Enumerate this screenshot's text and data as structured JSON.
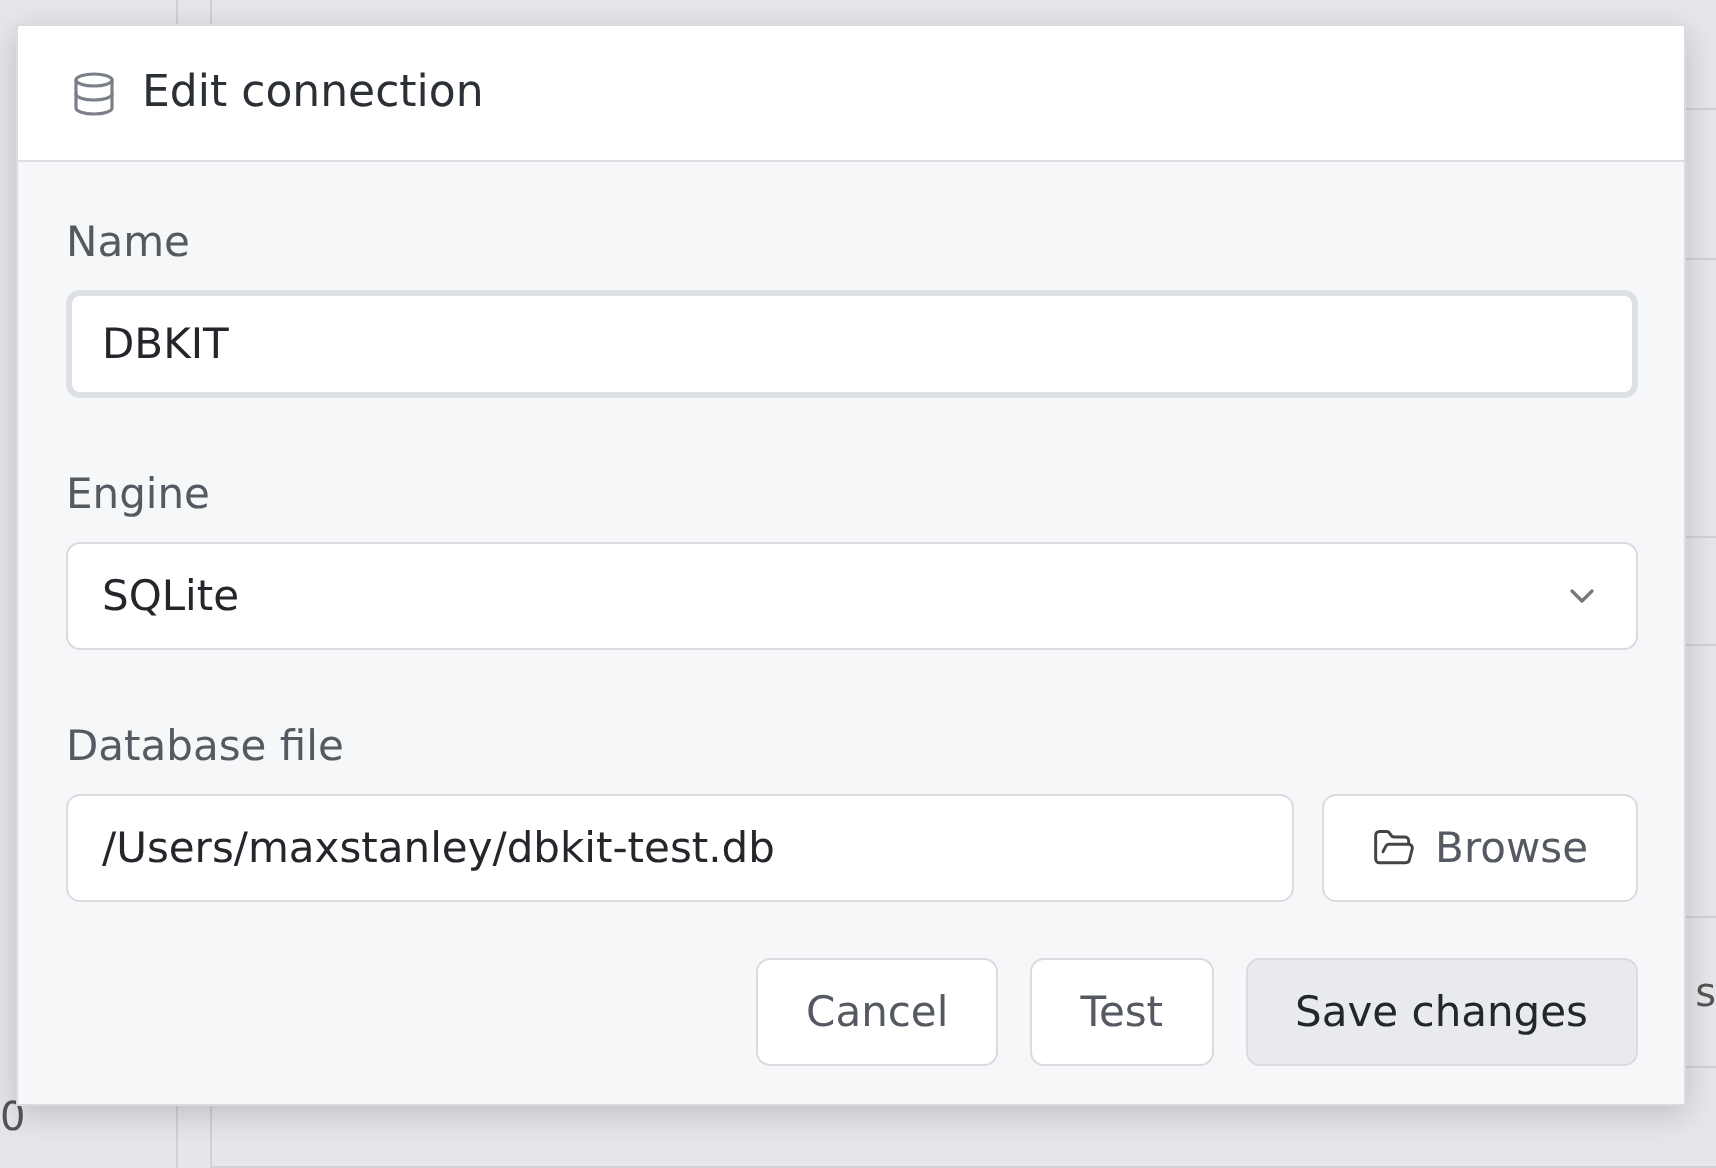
{
  "background": {
    "left_cells": [
      {
        "text": "0",
        "selected": false
      }
    ],
    "right_cells": [
      "s"
    ]
  },
  "dialog": {
    "title": "Edit connection",
    "fields": [
      {
        "kind": "text",
        "label": "Name",
        "value": "DBKIT",
        "focused": true
      },
      {
        "kind": "select",
        "label": "Engine",
        "value": "SQLite",
        "focused": false
      },
      {
        "kind": "file",
        "label": "Database file",
        "value": "/Users/maxstanley/dbkit-test.db",
        "focused": false,
        "button": "Browse"
      }
    ],
    "buttons": [
      {
        "label": "Cancel",
        "primary": false
      },
      {
        "label": "Test",
        "primary": false
      },
      {
        "label": "Save changes",
        "primary": true
      }
    ]
  }
}
